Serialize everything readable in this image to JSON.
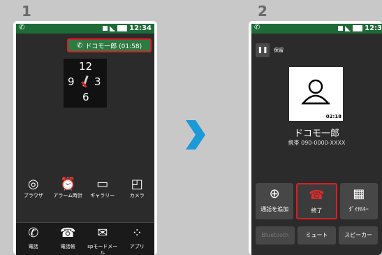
{
  "steps": {
    "one": "1",
    "two": "2"
  },
  "phone1": {
    "status_time": "12:34",
    "call_pill": "ドコモ一郎 (01:58)",
    "clock": {
      "n12": "12",
      "n9": "9",
      "n3": "3",
      "n6": "6"
    },
    "apps": [
      {
        "label": "ブラウザ",
        "icon": "globe-icon"
      },
      {
        "label": "アラーム時計",
        "icon": "alarm-clock-icon"
      },
      {
        "label": "ギャラリー",
        "icon": "gallery-icon"
      },
      {
        "label": "カメラ",
        "icon": "camera-icon"
      }
    ],
    "dock": [
      {
        "label": "電話",
        "icon": "phone-icon"
      },
      {
        "label": "電話帳",
        "icon": "contacts-icon"
      },
      {
        "label": "spモードメール",
        "icon": "mail-icon"
      },
      {
        "label": "アプリ",
        "icon": "apps-grid-icon"
      }
    ]
  },
  "phone2": {
    "status_time": "12:3",
    "hold_label": "保留",
    "call_timer": "02:18",
    "caller_name": "ドコモ一郎",
    "caller_number": "携帯 090-0000-XXXX",
    "buttons": [
      {
        "label": "通話を追加",
        "icon": "plus-circle-icon"
      },
      {
        "label": "終了",
        "icon": "hangup-icon"
      },
      {
        "label": "ﾀﾞｲﾔﾙｷｰ",
        "icon": "keypad-icon"
      }
    ],
    "buttons2": [
      {
        "label": "Bluetooth"
      },
      {
        "label": "ミュート"
      },
      {
        "label": "スピーカー"
      }
    ]
  }
}
